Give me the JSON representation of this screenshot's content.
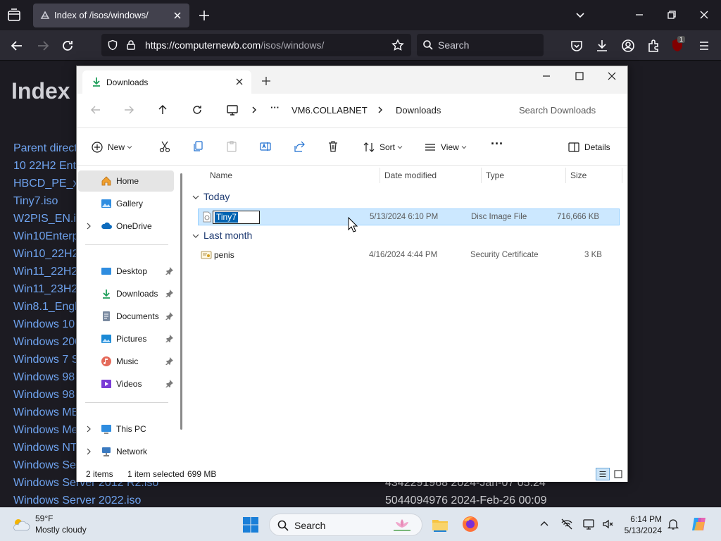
{
  "browser": {
    "tab_title": "Index of /isos/windows/",
    "url_domain": "https://computernewb.com",
    "url_path": "/isos/windows/",
    "search_placeholder": "Search",
    "extension_badge": "1"
  },
  "page": {
    "heading": "Index",
    "links": [
      "Parent direct",
      "10 22H2 Ente",
      "HBCD_PE_x6",
      "Tiny7.iso",
      "W2PIS_EN.isc",
      "Win10Enterp",
      "Win10_22H2",
      "Win11_22H2",
      "Win11_23H2",
      "Win8.1_Engli",
      "Windows 10",
      "Windows 200",
      "Windows 7 S",
      "Windows 98",
      "Windows 98",
      "Windows ME",
      "Windows Me",
      "Windows NT",
      "Windows Se",
      "Windows Server 2012 R2.iso",
      "Windows Server 2022.iso"
    ],
    "meta_rows": [
      "4342291968 2024-Jan-07 05:24",
      "5044094976 2024-Feb-26 00:09"
    ]
  },
  "explorer": {
    "tab_title": "Downloads",
    "breadcrumb": [
      "VM6.COLLABNET",
      "Downloads"
    ],
    "search_placeholder": "Search Downloads",
    "toolbar": {
      "new_label": "New",
      "sort_label": "Sort",
      "view_label": "View",
      "details_label": "Details"
    },
    "nav": {
      "home": "Home",
      "gallery": "Gallery",
      "onedrive": "OneDrive",
      "desktop": "Desktop",
      "downloads": "Downloads",
      "documents": "Documents",
      "pictures": "Pictures",
      "music": "Music",
      "videos": "Videos",
      "this_pc": "This PC",
      "network": "Network"
    },
    "columns": [
      "Name",
      "Date modified",
      "Type",
      "Size"
    ],
    "groups": [
      {
        "label": "Today",
        "files": [
          {
            "name": "Tiny7",
            "date": "5/13/2024 6:10 PM",
            "type": "Disc Image File",
            "size": "716,666 KB",
            "selected": true,
            "renaming": true
          }
        ]
      },
      {
        "label": "Last month",
        "files": [
          {
            "name": "penis",
            "date": "4/16/2024 4:44 PM",
            "type": "Security Certificate",
            "size": "3 KB",
            "selected": false,
            "renaming": false
          }
        ]
      }
    ],
    "status": {
      "count": "2 items",
      "selection": "1 item selected",
      "sel_size": "699 MB"
    }
  },
  "taskbar": {
    "weather_temp": "59°F",
    "weather_cond": "Mostly cloudy",
    "search_label": "Search",
    "time": "6:14 PM",
    "date": "5/13/2024"
  }
}
